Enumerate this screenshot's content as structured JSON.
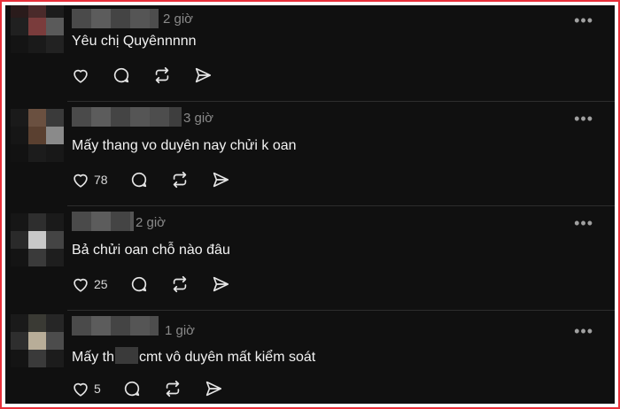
{
  "comments": [
    {
      "time": "2 giờ",
      "text": "Yêu chị Quyênnnnn",
      "likes": ""
    },
    {
      "time": "3 giờ",
      "text": "Mấy thang vo duyên nay chửi k oan",
      "likes": "78"
    },
    {
      "time": "2 giờ",
      "text": "Bả chửi oan chỗ nào đâu",
      "likes": "25"
    },
    {
      "time": "1 giờ",
      "text_before": "Mấy th",
      "text_after": "cmt vô duyên mất kiểm soát",
      "likes": "5"
    }
  ],
  "more_label": "•••",
  "icons": [
    "heart-icon",
    "comment-icon",
    "repost-icon",
    "share-icon",
    "more-icon"
  ],
  "colors": {
    "background": "#101010",
    "frame": "#e8303a",
    "text": "#f2f2f2",
    "muted": "#8a8a8a"
  }
}
